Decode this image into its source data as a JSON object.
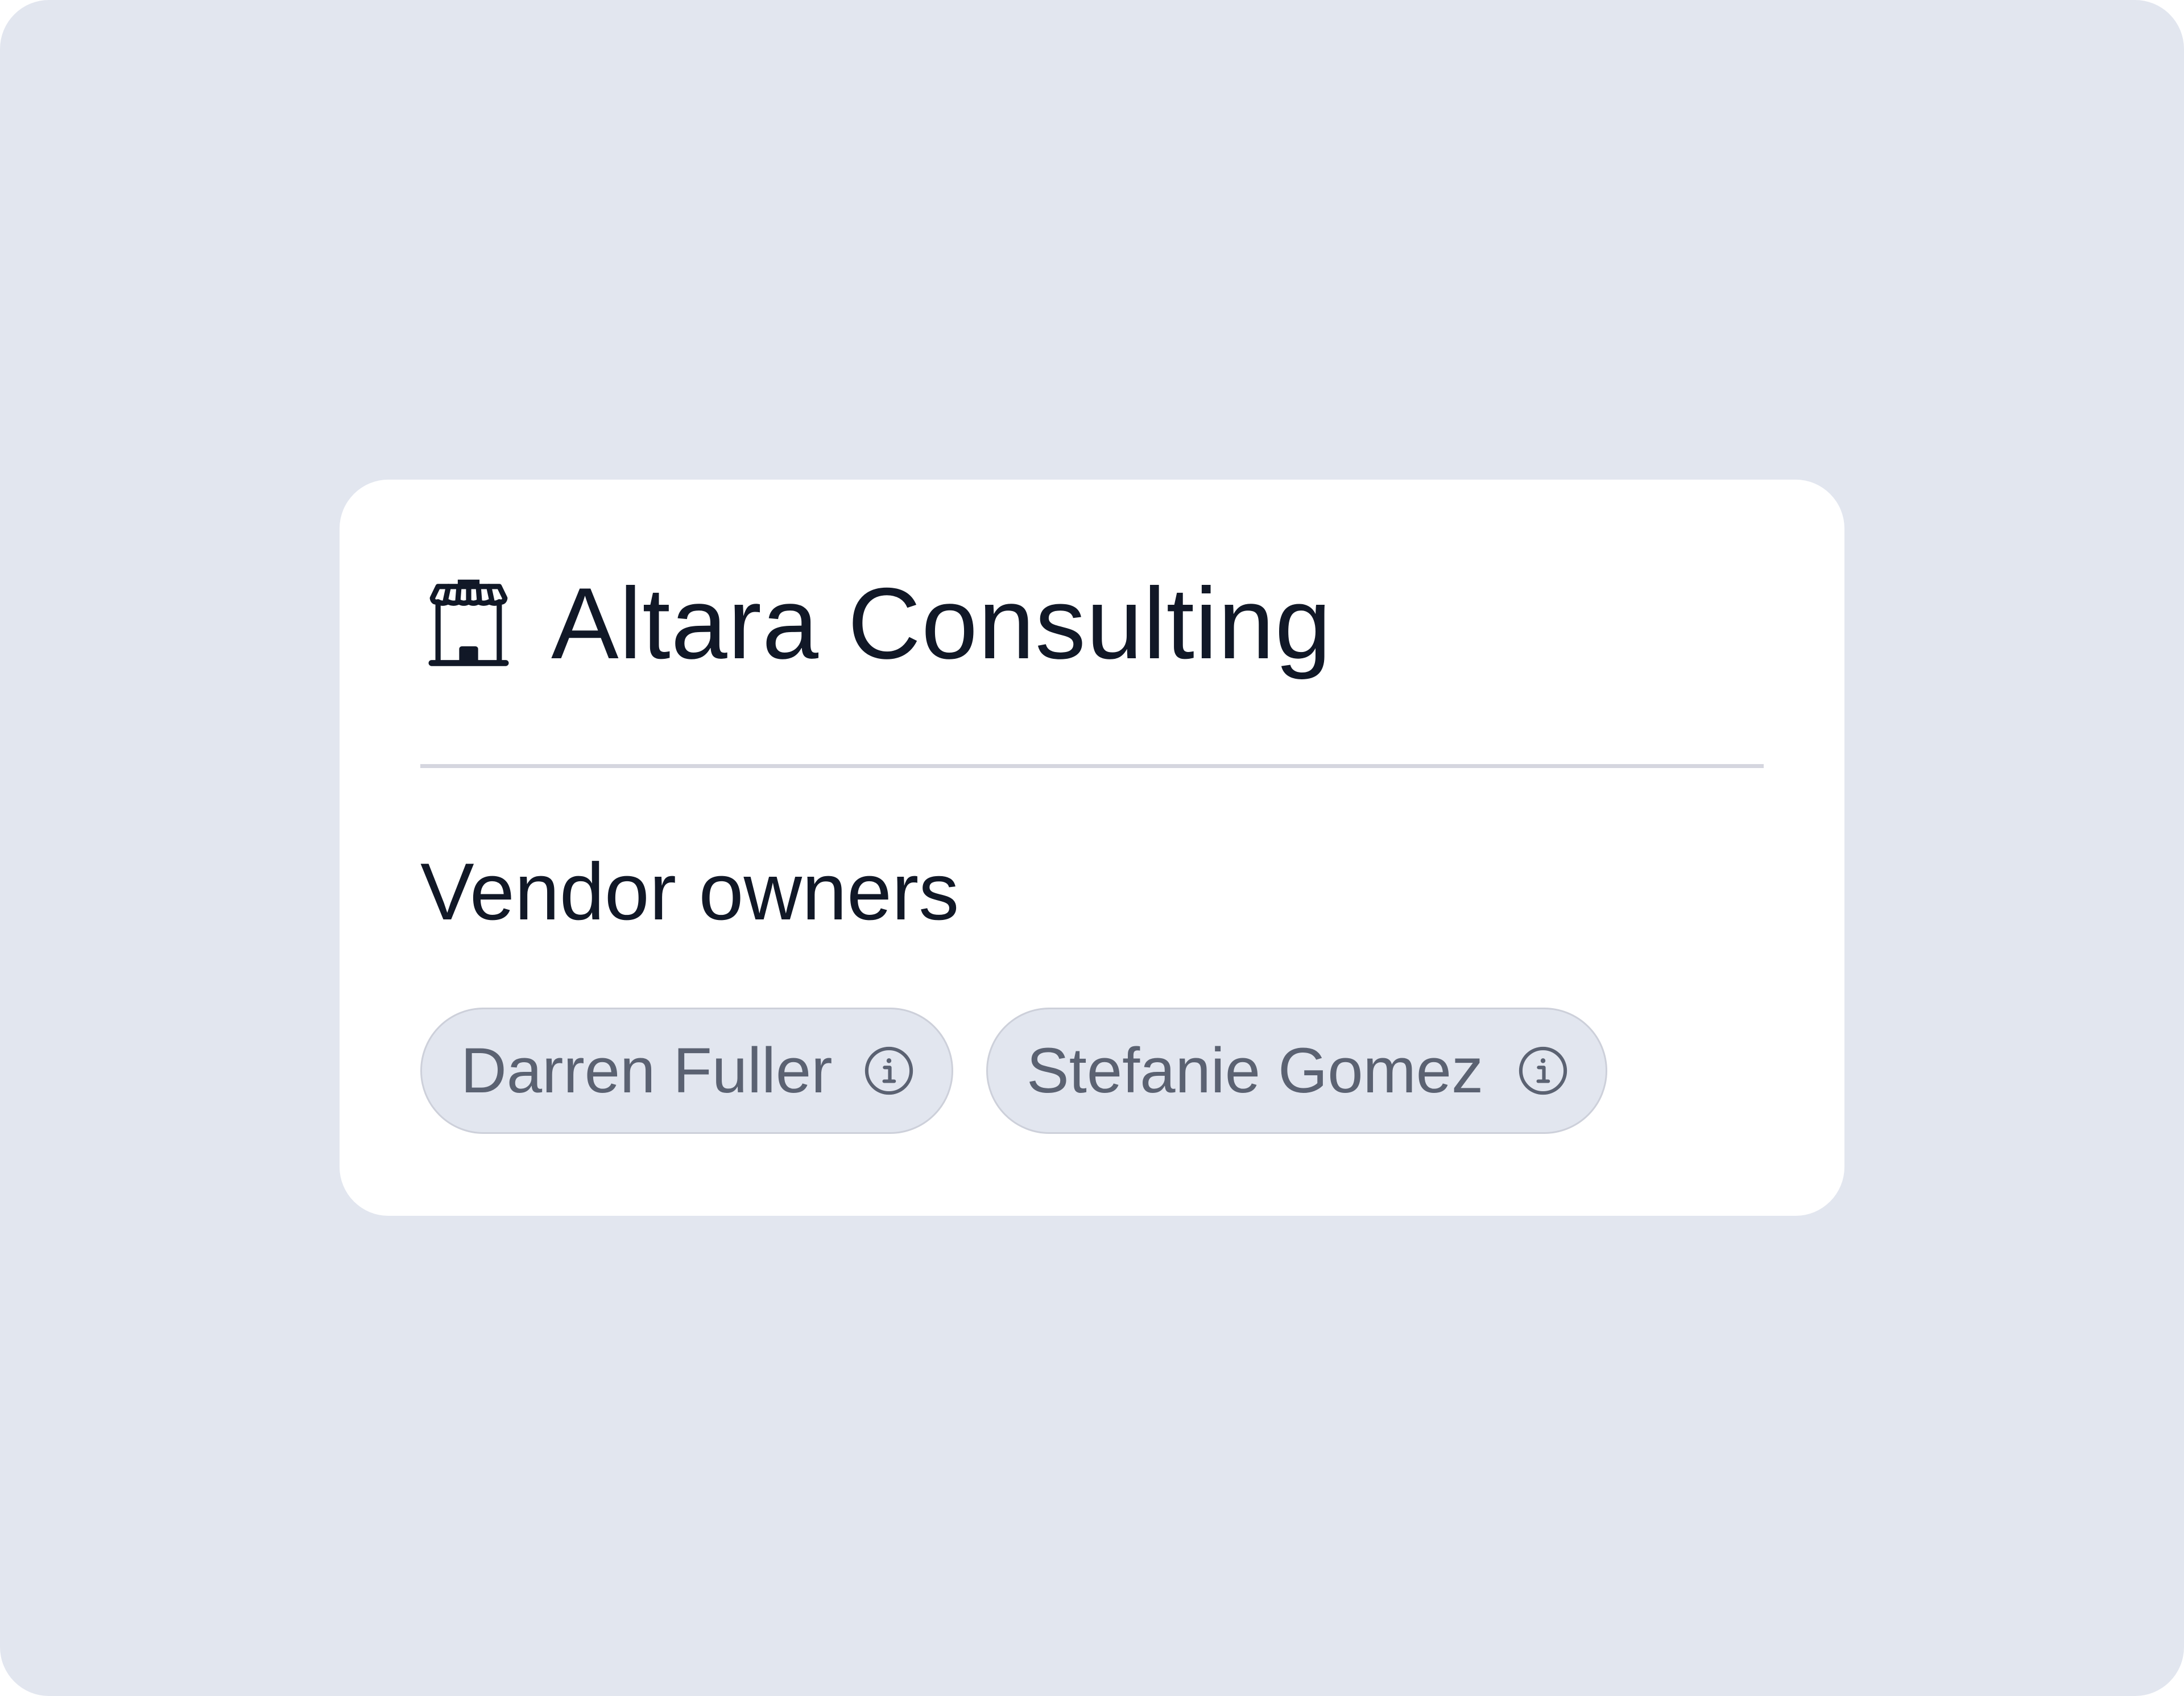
{
  "vendor": {
    "name": "Altara Consulting",
    "icon": "store-icon"
  },
  "owners": {
    "section_label": "Vendor owners",
    "items": [
      {
        "name": "Darren Fuller",
        "icon": "info-icon"
      },
      {
        "name": "Stefanie Gomez",
        "icon": "info-icon"
      }
    ]
  },
  "colors": {
    "background": "#e2e6ef",
    "card": "#ffffff",
    "text_primary": "#111827",
    "chip_text": "#5b6272",
    "chip_border": "#cdd0da",
    "divider": "#d5d6df"
  }
}
